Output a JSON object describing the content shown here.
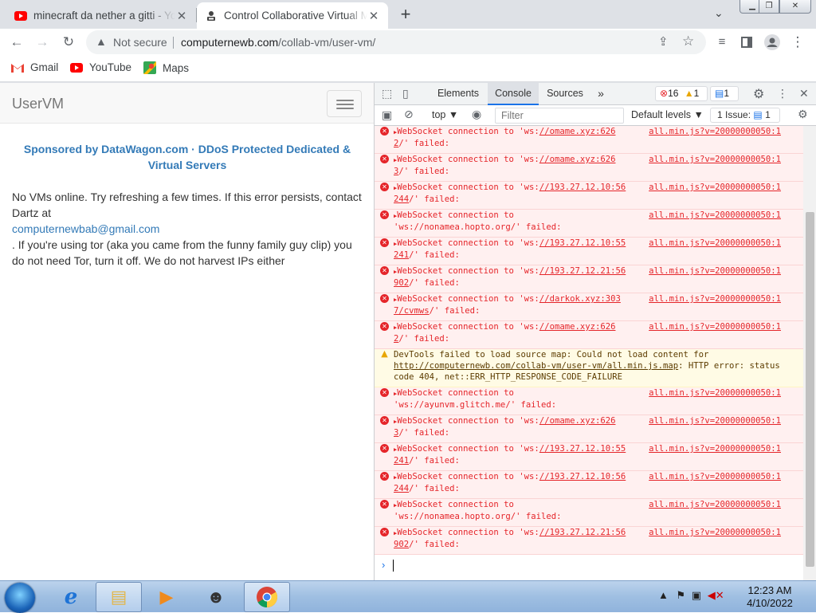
{
  "browser": {
    "tabs": [
      {
        "title": "minecraft da nether a gitti - Yo",
        "close": "✕"
      },
      {
        "title": "Control Collaborative Virtual M",
        "close": "✕"
      }
    ],
    "new_tab": "+",
    "address": {
      "security": "Not secure",
      "host": "computernewb.com",
      "path": "/collab-vm/user-vm/"
    },
    "bookmarks": [
      {
        "label": "Gmail"
      },
      {
        "label": "YouTube"
      },
      {
        "label": "Maps"
      }
    ]
  },
  "page": {
    "brand": "UserVM",
    "sponsor": "Sponsored by DataWagon.com · DDoS Protected Dedicated & Virtual Servers",
    "message_1": "No VMs online. Try refreshing a few times. If this error persists, contact Dartz at",
    "email": "computernewbab@gmail.com",
    "message_2": ". If you're using tor (aka you came from the funny family guy clip) you do not need Tor, turn it off. We do not harvest IPs either"
  },
  "devtools": {
    "tabs": [
      "Elements",
      "Console",
      "Sources"
    ],
    "more": "»",
    "errors": "16",
    "warnings": "1",
    "messages": "1",
    "context": "top ▼",
    "filter_placeholder": "Filter",
    "levels": "Default levels ▼",
    "issues_label": "1 Issue:",
    "issues_count": "1",
    "prompt": "›",
    "console": [
      {
        "type": "error",
        "pre": "WebSocket connection to 'ws:",
        "url": "//omame.xyz:626",
        "tail": "2",
        "end": "/' failed:",
        "source": "all.min.js?v=20000000050:1"
      },
      {
        "type": "error",
        "pre": "WebSocket connection to 'ws:",
        "url": "//omame.xyz:626",
        "tail": "3",
        "end": "/' failed:",
        "source": "all.min.js?v=20000000050:1"
      },
      {
        "type": "error",
        "pre": "WebSocket connection to 'ws:",
        "url": "//193.27.12.10:56",
        "tail": "244",
        "end": "/' failed:",
        "source": "all.min.js?v=20000000050:1"
      },
      {
        "type": "error",
        "pre": "WebSocket connection to",
        "url": "",
        "tail": "",
        "end": "'ws://nonamea.hopto.org/' failed:",
        "source": "all.min.js?v=20000000050:1"
      },
      {
        "type": "error",
        "pre": "WebSocket connection to 'ws:",
        "url": "//193.27.12.10:55",
        "tail": "241",
        "end": "/' failed:",
        "source": "all.min.js?v=20000000050:1"
      },
      {
        "type": "error",
        "pre": "WebSocket connection to 'ws:",
        "url": "//193.27.12.21:56",
        "tail": "902",
        "end": "/' failed:",
        "source": "all.min.js?v=20000000050:1"
      },
      {
        "type": "error",
        "pre": "WebSocket connection to 'ws:",
        "url": "//darkok.xyz:303",
        "tail": "7/cvmws",
        "end": "/' failed:",
        "source": "all.min.js?v=20000000050:1"
      },
      {
        "type": "error",
        "pre": "WebSocket connection to 'ws:",
        "url": "//omame.xyz:626",
        "tail": "2",
        "end": "/' failed:",
        "source": "all.min.js?v=20000000050:1"
      },
      {
        "type": "warn",
        "pre": "DevTools failed to load source map: Could not load content for ",
        "url": "http://computernewb.com/collab-vm/user-vm/all.min.js.map",
        "tail": "",
        "end": ": HTTP error: status code 404, net::ERR_HTTP_RESPONSE_CODE_FAILURE",
        "source": ""
      },
      {
        "type": "error",
        "pre": "WebSocket connection to",
        "url": "",
        "tail": "",
        "end": "'ws://ayunvm.glitch.me/' failed:",
        "source": "all.min.js?v=20000000050:1"
      },
      {
        "type": "error",
        "pre": "WebSocket connection to 'ws:",
        "url": "//omame.xyz:626",
        "tail": "3",
        "end": "/' failed:",
        "source": "all.min.js?v=20000000050:1"
      },
      {
        "type": "error",
        "pre": "WebSocket connection to 'ws:",
        "url": "//193.27.12.10:55",
        "tail": "241",
        "end": "/' failed:",
        "source": "all.min.js?v=20000000050:1"
      },
      {
        "type": "error",
        "pre": "WebSocket connection to 'ws:",
        "url": "//193.27.12.10:56",
        "tail": "244",
        "end": "/' failed:",
        "source": "all.min.js?v=20000000050:1"
      },
      {
        "type": "error",
        "pre": "WebSocket connection to",
        "url": "",
        "tail": "",
        "end": "'ws://nonamea.hopto.org/' failed:",
        "source": "all.min.js?v=20000000050:1"
      },
      {
        "type": "error",
        "pre": "WebSocket connection to 'ws:",
        "url": "//193.27.12.21:56",
        "tail": "902",
        "end": "/' failed:",
        "source": "all.min.js?v=20000000050:1"
      }
    ]
  },
  "taskbar": {
    "time": "12:23 AM",
    "date": "4/10/2022",
    "icons": [
      "start-orb-icon",
      "ie-icon",
      "explorer-icon",
      "media-player-icon",
      "raccoon-app-icon",
      "chrome-icon"
    ]
  },
  "colors": {
    "error": "#e5252a",
    "link": "#337ab7",
    "accent": "#1a73e8"
  }
}
